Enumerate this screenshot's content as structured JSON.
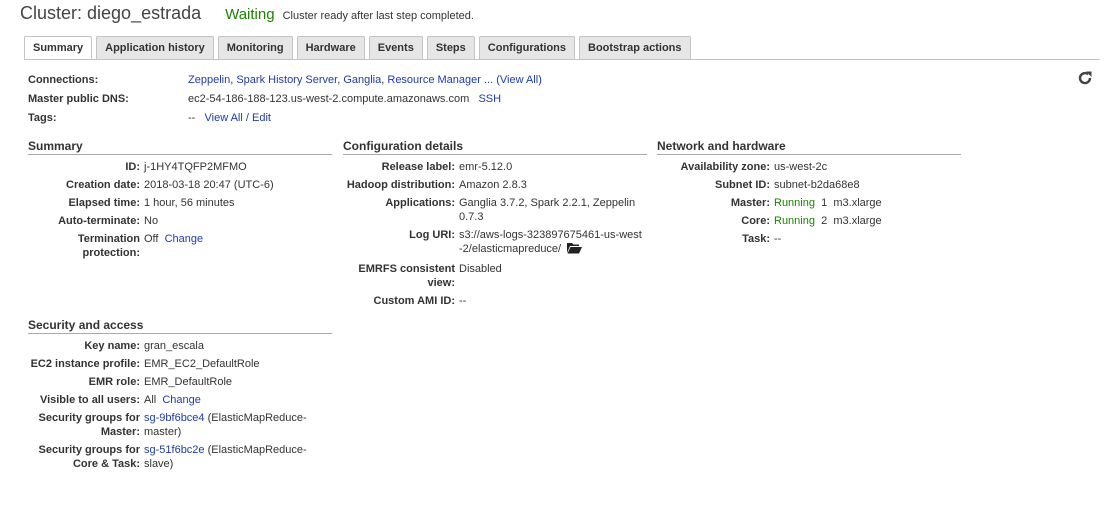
{
  "header": {
    "title": "Cluster: diego_estrada",
    "status": "Waiting",
    "status_message": "Cluster ready after last step completed."
  },
  "tabs": [
    {
      "label": "Summary",
      "active": true
    },
    {
      "label": "Application history"
    },
    {
      "label": "Monitoring"
    },
    {
      "label": "Hardware"
    },
    {
      "label": "Events"
    },
    {
      "label": "Steps"
    },
    {
      "label": "Configurations"
    },
    {
      "label": "Bootstrap actions"
    }
  ],
  "top_info": {
    "connections_label": "Connections:",
    "connections_links": [
      "Zeppelin",
      "Spark History Server",
      "Ganglia",
      "Resource Manager"
    ],
    "connections_more": " ... ",
    "connections_view_all": "(View All)",
    "dns_label": "Master public DNS:",
    "dns_value": "ec2-54-186-188-123.us-west-2.compute.amazonaws.com",
    "ssh_link": "SSH",
    "tags_label": "Tags:",
    "tags_value": "--",
    "tags_link": "View All / Edit"
  },
  "summary": {
    "title": "Summary",
    "id_label": "ID:",
    "id_value": "j-1HY4TQFP2MFMO",
    "creation_label": "Creation date:",
    "creation_value": "2018-03-18 20:47 (UTC-6)",
    "elapsed_label": "Elapsed time:",
    "elapsed_value": "1 hour, 56 minutes",
    "autoterm_label": "Auto-terminate:",
    "autoterm_value": "No",
    "termprot_label": "Termination protection:",
    "termprot_value": "Off",
    "termprot_link": "Change"
  },
  "config": {
    "title": "Configuration details",
    "release_label": "Release label:",
    "release_value": "emr-5.12.0",
    "hadoop_label": "Hadoop distribution:",
    "hadoop_value": "Amazon 2.8.3",
    "apps_label": "Applications:",
    "apps_value": "Ganglia 3.7.2, Spark 2.2.1, Zeppelin 0.7.3",
    "loguri_label": "Log URI:",
    "loguri_value": "s3://aws-logs-323897675461-us-west-2/elasticmapreduce/",
    "emrfs_label": "EMRFS consistent view:",
    "emrfs_value": "Disabled",
    "ami_label": "Custom AMI ID:",
    "ami_value": "--"
  },
  "network": {
    "title": "Network and hardware",
    "az_label": "Availability zone:",
    "az_value": "us-west-2c",
    "subnet_label": "Subnet ID:",
    "subnet_value": "subnet-b2da68e8",
    "master_label": "Master:",
    "master_status": "Running",
    "master_count": "1",
    "master_type": "m3.xlarge",
    "core_label": "Core:",
    "core_status": "Running",
    "core_count": "2",
    "core_type": "m3.xlarge",
    "task_label": "Task:",
    "task_value": "--"
  },
  "security": {
    "title": "Security and access",
    "key_label": "Key name:",
    "key_value": "gran_escala",
    "profile_label": "EC2 instance profile:",
    "profile_value": "EMR_EC2_DefaultRole",
    "role_label": "EMR role:",
    "role_value": "EMR_DefaultRole",
    "visible_label": "Visible to all users:",
    "visible_value": "All",
    "visible_link": "Change",
    "sg_master_label": "Security groups for Master:",
    "sg_master_link": "sg-9bf6bce4",
    "sg_master_desc": "(ElasticMapReduce-master)",
    "sg_core_label": "Security groups for Core & Task:",
    "sg_core_link": "sg-51f6bc2e",
    "sg_core_desc": "(ElasticMapReduce-slave)"
  },
  "icons": {
    "refresh": "refresh-icon",
    "folder": "folder-icon"
  }
}
